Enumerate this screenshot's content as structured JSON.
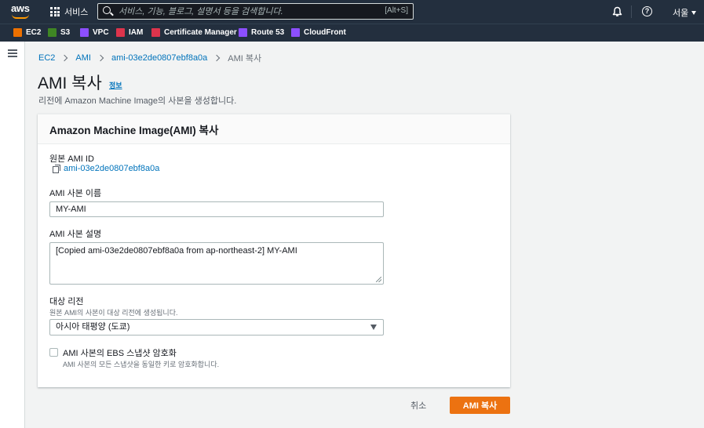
{
  "topnav": {
    "logo_text": "aws",
    "services_label": "서비스",
    "search_placeholder": "서비스, 기능, 블로그, 설명서 등을 검색합니다.",
    "search_shortcut": "[Alt+S]",
    "help_glyph": "?",
    "region_label": "서울"
  },
  "favorites": [
    {
      "label": "EC2",
      "color": "#ed7100"
    },
    {
      "label": "S3",
      "color": "#3f8624"
    },
    {
      "label": "VPC",
      "color": "#8c4fff"
    },
    {
      "label": "IAM",
      "color": "#dd344c"
    },
    {
      "label": "Certificate Manager",
      "color": "#dd344c"
    },
    {
      "label": "Route 53",
      "color": "#8c4fff"
    },
    {
      "label": "CloudFront",
      "color": "#8c4fff"
    }
  ],
  "breadcrumb": {
    "items": [
      "EC2",
      "AMI",
      "ami-03e2de0807ebf8a0a"
    ],
    "current": "AMI 복사"
  },
  "page": {
    "title": "AMI 복사",
    "info_link": "정보",
    "subtitle": "리전에 Amazon Machine Image의 사본을 생성합니다."
  },
  "panel": {
    "header": "Amazon Machine Image(AMI) 복사",
    "source_label": "원본 AMI ID",
    "source_value": "ami-03e2de0807ebf8a0a",
    "name_label": "AMI 사본 이름",
    "name_value": "MY-AMI",
    "desc_label": "AMI 사본 설명",
    "desc_value": "[Copied ami-03e2de0807ebf8a0a from ap-northeast-2] MY-AMI",
    "region_label": "대상 리전",
    "region_desc": "원본 AMI의 사본이 대상 리전에 생성됩니다.",
    "region_value": "아시아 태평양 (도쿄)",
    "encrypt_label": "AMI 사본의 EBS 스냅샷 암호화",
    "encrypt_desc": "AMI 사본의 모든 스냅샷을 동일한 키로 암호화합니다.",
    "encrypt_checked": false
  },
  "actions": {
    "cancel": "취소",
    "submit": "AMI 복사"
  },
  "colors": {
    "nav_bg": "#232f3e",
    "accent": "#ec7211",
    "link": "#0073bb"
  }
}
